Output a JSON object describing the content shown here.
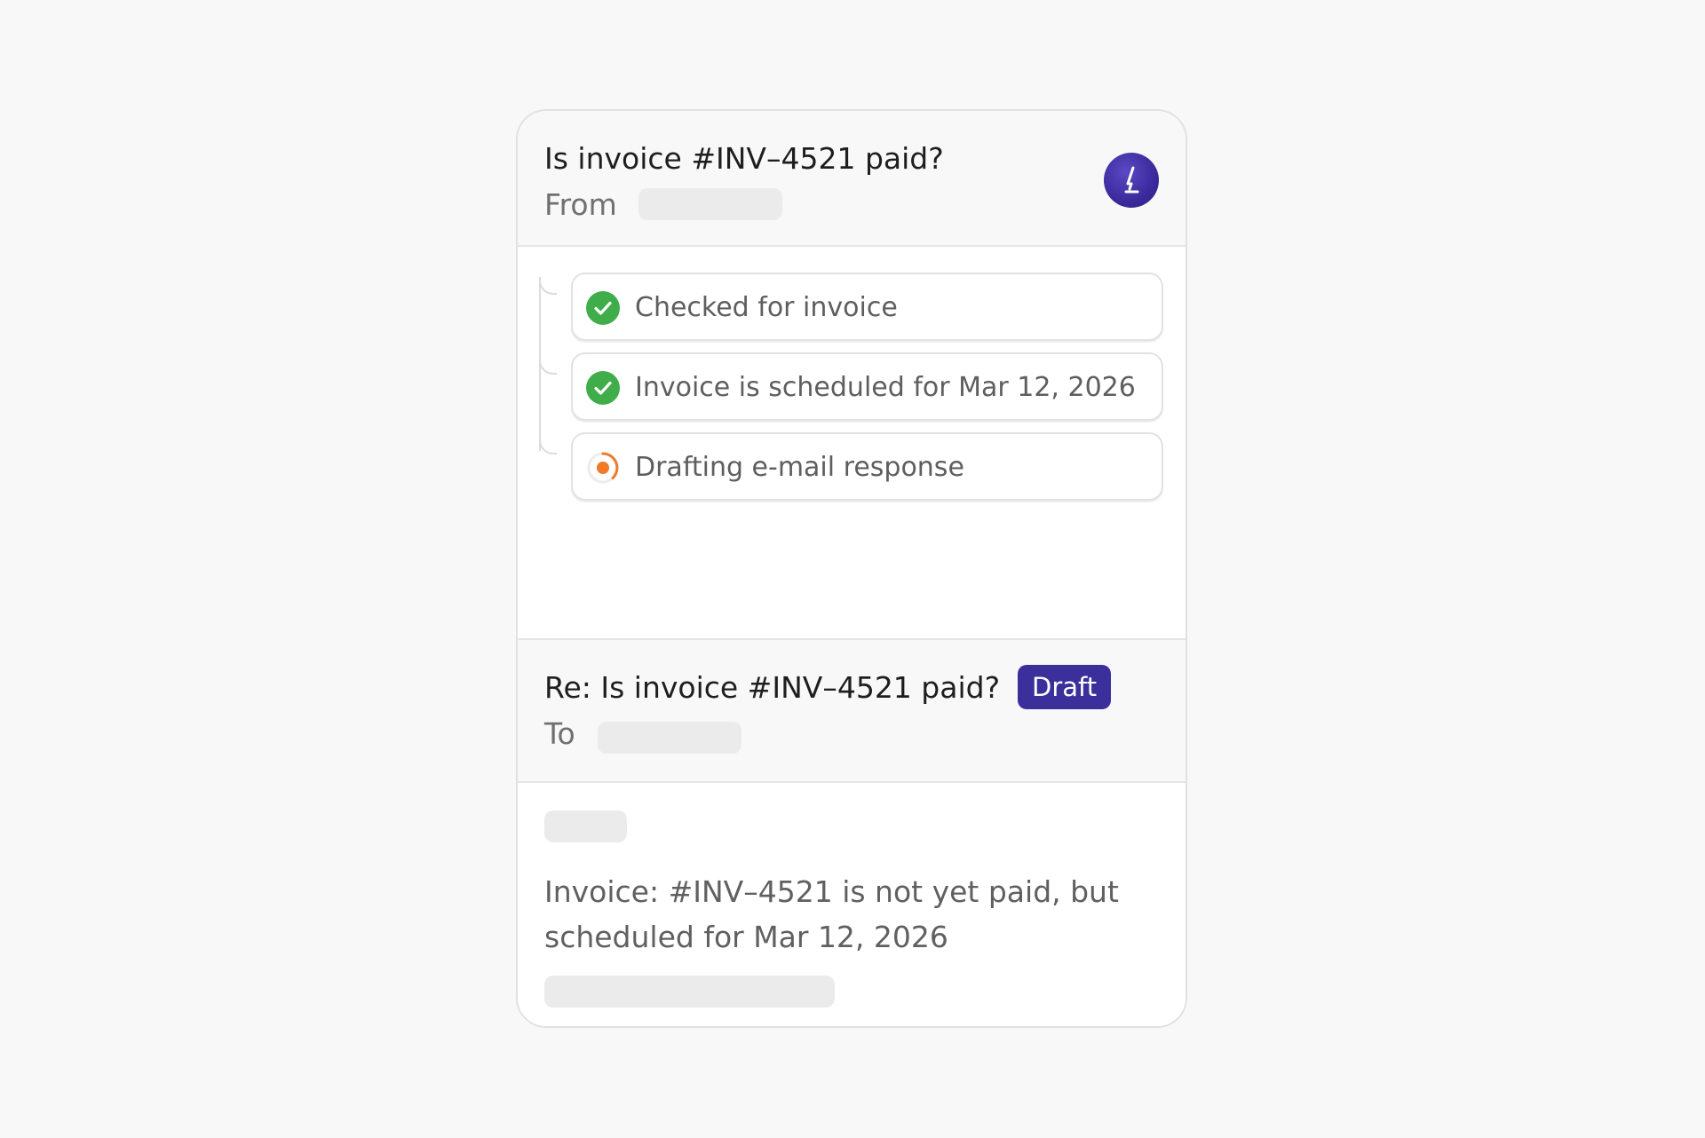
{
  "incoming": {
    "subject": "Is invoice #INV–4521 paid?",
    "from_label": "From",
    "avatar_icon": "lightning-logo-icon"
  },
  "steps": [
    {
      "label": "Checked for invoice",
      "status": "done",
      "icon": "check-circle-icon"
    },
    {
      "label": "Invoice is scheduled for Mar 12, 2026",
      "status": "done",
      "icon": "check-circle-icon"
    },
    {
      "label": "Drafting e-mail response",
      "status": "in-progress",
      "icon": "spinner-icon"
    }
  ],
  "reply": {
    "subject": "Re: Is invoice #INV–4521 paid?",
    "badge": "Draft",
    "to_label": "To"
  },
  "body": {
    "text": "Invoice: #INV–4521 is not yet paid, but scheduled for Mar 12, 2026"
  },
  "colors": {
    "accent": "#3b2f9c",
    "success": "#3fae4a",
    "in_progress": "#f07a26",
    "skeleton": "#ebebeb"
  }
}
